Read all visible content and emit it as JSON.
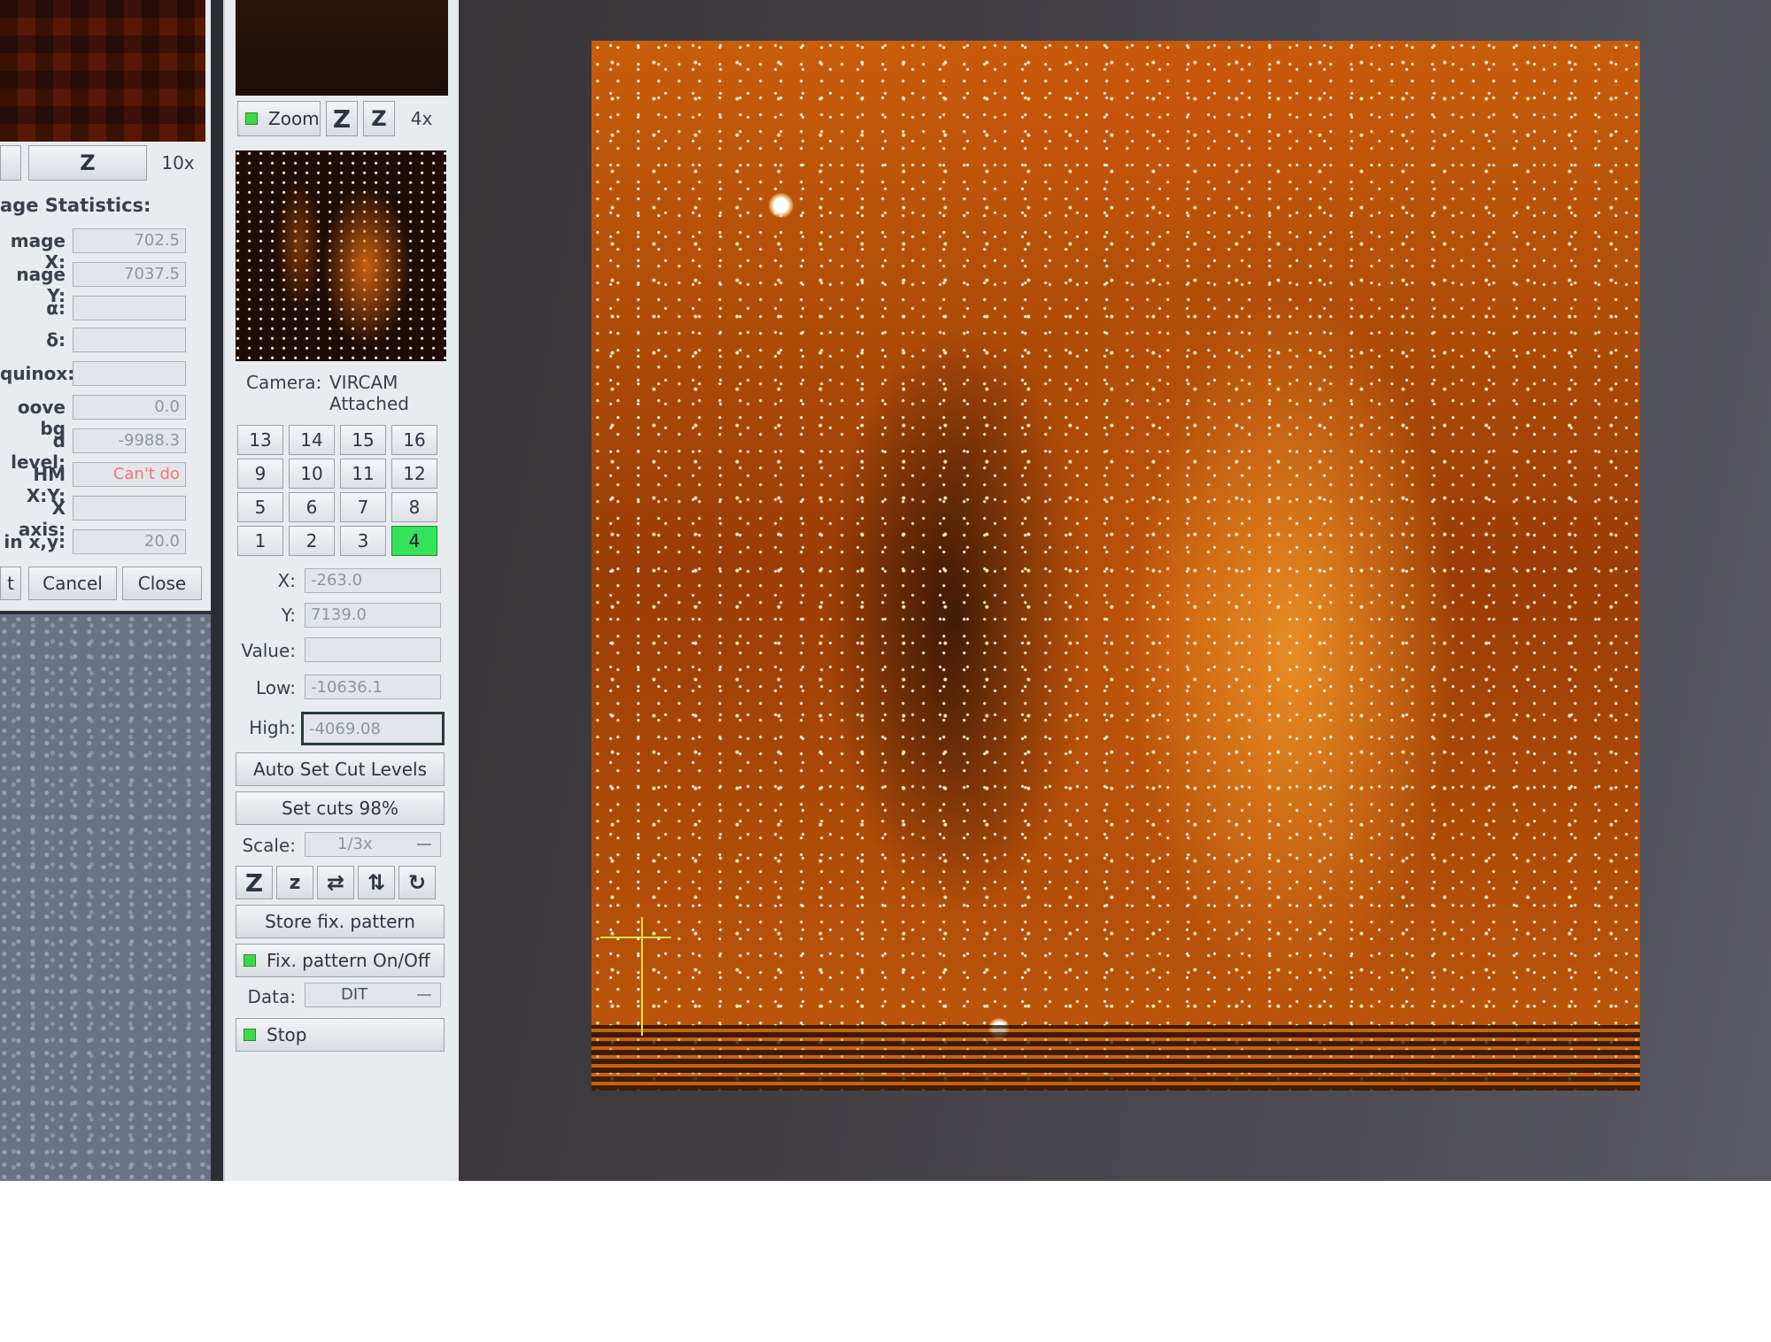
{
  "stats_panel": {
    "zoom_button": "Z",
    "zoom_factor": "10x",
    "heading": "age Statistics:",
    "rows": [
      {
        "label": "mage X:",
        "value": "702.5"
      },
      {
        "label": "nage Y:",
        "value": "7037.5"
      },
      {
        "label": "α:",
        "value": ""
      },
      {
        "label": "δ:",
        "value": ""
      },
      {
        "label": "quinox:",
        "value": ""
      },
      {
        "label": "oove bg",
        "value": "0.0"
      },
      {
        "label": "d level:",
        "value": "-9988.3"
      },
      {
        "label": "HM X:Y:",
        "value": "Can't do"
      },
      {
        "label": "X axis:",
        "value": ""
      },
      {
        "label": "in x,y:",
        "value": "20.0"
      }
    ],
    "buttons": [
      "t",
      "Cancel",
      "Close"
    ]
  },
  "control_panel": {
    "zoom_label": "Zoom",
    "zoom_in": "Z",
    "zoom_out": "Z",
    "zoom_factor": "4x",
    "camera_label": "Camera:",
    "camera_name": "VIRCAM",
    "camera_status": "Attached",
    "detectors": [
      "13",
      "14",
      "15",
      "16",
      "9",
      "10",
      "11",
      "12",
      "5",
      "6",
      "7",
      "8",
      "1",
      "2",
      "3",
      "4"
    ],
    "active_detector": "4",
    "x_label": "X:",
    "x_value": "-263.0",
    "y_label": "Y:",
    "y_value": "7139.0",
    "value_label": "Value:",
    "value_value": "",
    "low_label": "Low:",
    "low_value": "-10636.1",
    "high_label": "High:",
    "high_value": "-4069.08",
    "auto_cut": "Auto Set Cut Levels",
    "set_cuts": "Set cuts 98%",
    "scale_label": "Scale:",
    "scale_value": "1/3x",
    "store_pattern": "Store fix. pattern",
    "fix_pattern": "Fix. pattern On/Off",
    "data_label": "Data:",
    "data_value": "DIT",
    "stop": "Stop"
  },
  "colors": {
    "accent_active": "#35e35a",
    "led": "#3fd84a",
    "cant_do": "#f07a70",
    "image_orange": "#e07a12"
  }
}
